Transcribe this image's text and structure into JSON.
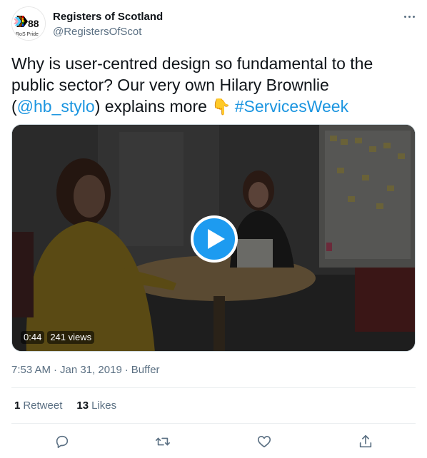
{
  "account": {
    "name": "Registers of Scotland",
    "handle": "@RegistersOfScot",
    "avatar_text": "RoS Pride",
    "avatar_number": "88"
  },
  "tweet": {
    "text_part1": "Why is user-centred design so fundamental to the public sector? Our very own Hilary Brownlie (",
    "mention": "@hb_stylo",
    "text_part2": ") explains more ",
    "emoji": "👇",
    "hashtag": "#ServicesWeek"
  },
  "video": {
    "duration": "0:44",
    "views": "241 views"
  },
  "meta": {
    "time": "7:53 AM",
    "date": "Jan 31, 2019",
    "separator": "·",
    "source": "Buffer"
  },
  "stats": {
    "retweets_count": "1",
    "retweets_label": "Retweet",
    "likes_count": "13",
    "likes_label": "Likes"
  },
  "icons": {
    "more": "more-icon",
    "reply": "reply-icon",
    "retweet": "retweet-icon",
    "like": "like-icon",
    "share": "share-icon",
    "play": "play-icon"
  },
  "colors": {
    "accent": "#1d9bf0",
    "link": "#1b95e0",
    "secondary_text": "#5b7083",
    "primary_text": "#0f1419"
  }
}
